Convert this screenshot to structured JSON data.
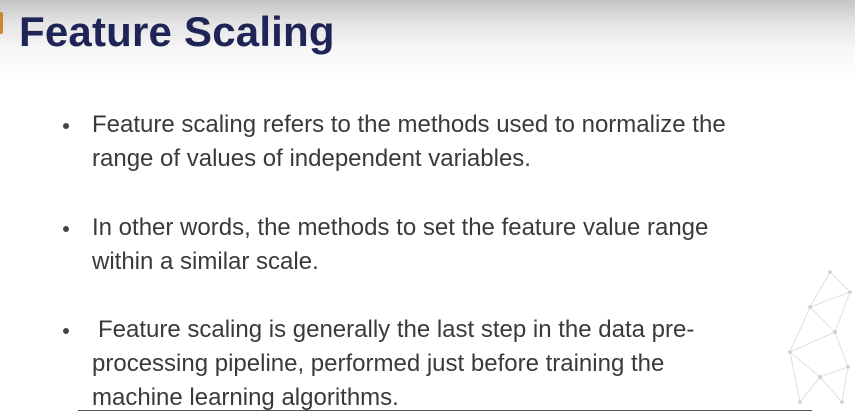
{
  "slide": {
    "title": "Feature Scaling",
    "bullets": [
      {
        "lines": [
          "Feature scaling refers to the methods used to normalize the",
          "range of values of independent variables."
        ]
      },
      {
        "lines": [
          "In other words, the methods to set the feature value range",
          "within a similar scale."
        ]
      },
      {
        "lines": [
          "Feature scaling is generally the last step in the data pre-",
          "processing pipeline, performed just before training the",
          "machine learning algorithms."
        ]
      }
    ]
  },
  "colors": {
    "title": "#1f2456",
    "body_text": "#3a3a3a",
    "accent": "#c98a2a",
    "decoration": "#d8d8d8"
  },
  "icons": {
    "bullet": "bullet-dot-icon",
    "decoration": "network-graph-decoration"
  }
}
